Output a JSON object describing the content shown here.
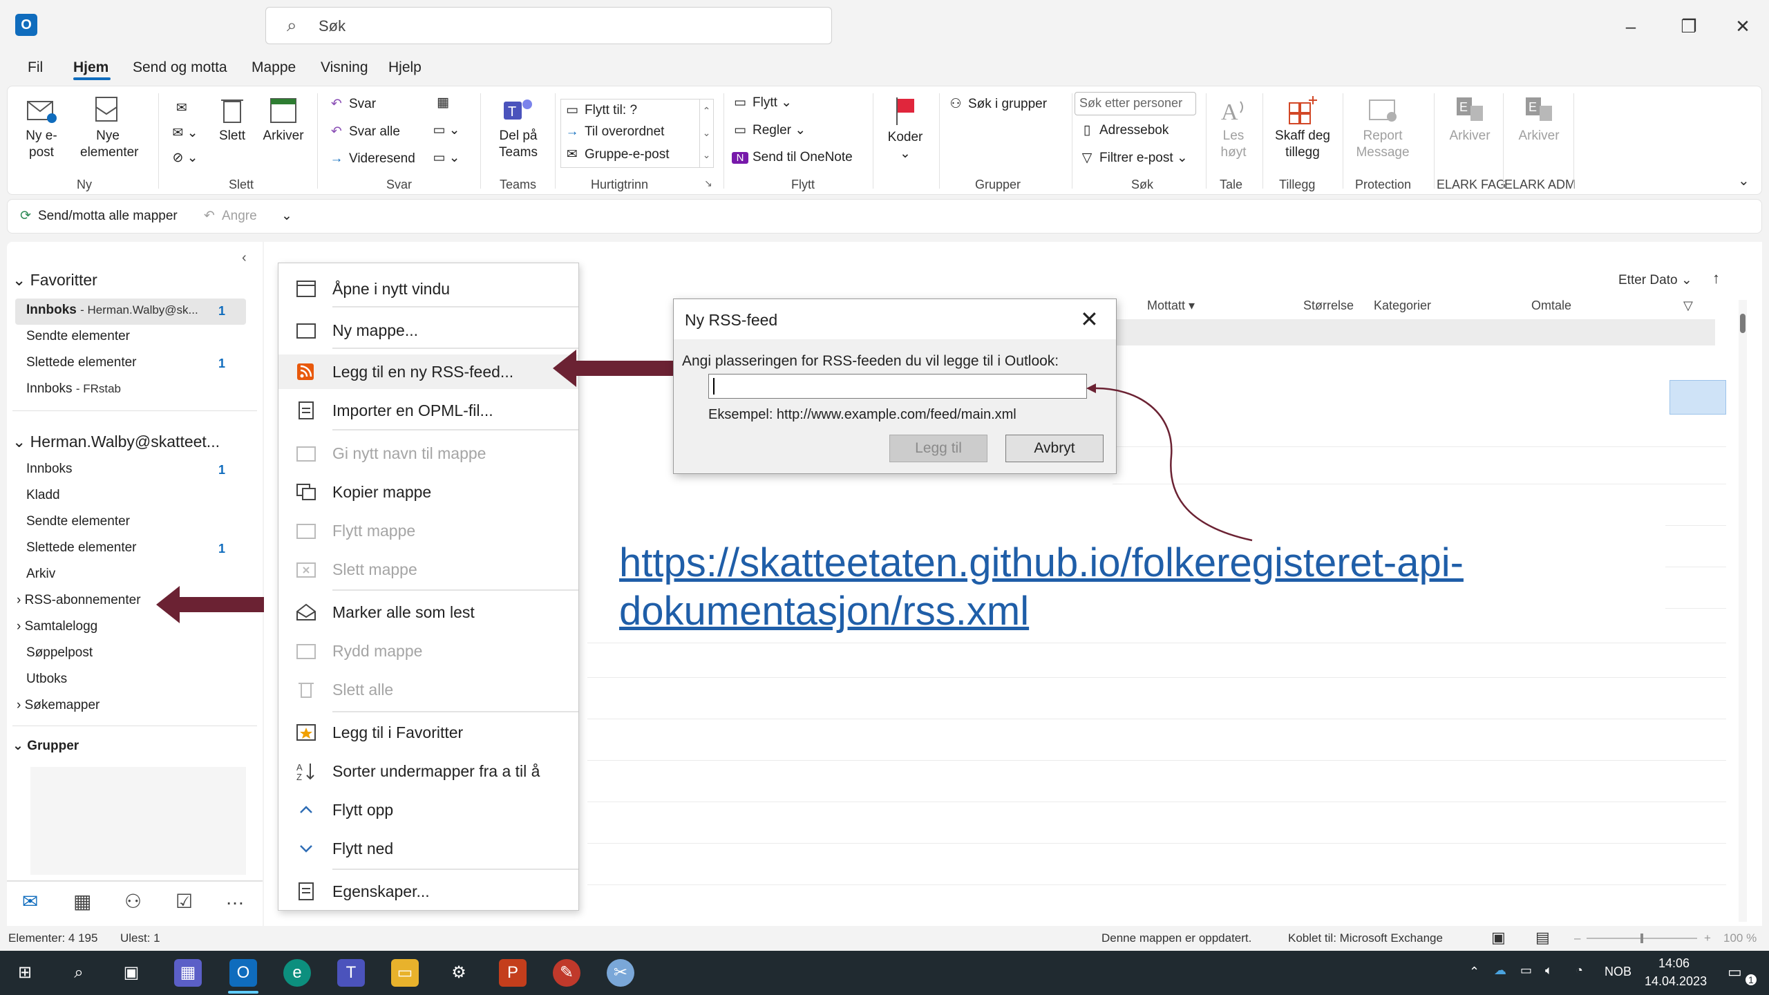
{
  "app": {
    "search_placeholder": "Søk",
    "colors": {
      "accent": "#0f6cbd",
      "arrow": "#6b2233",
      "link": "#1f5ea8"
    }
  },
  "menu": {
    "tabs": [
      "Fil",
      "Hjem",
      "Send og motta",
      "Mappe",
      "Visning",
      "Hjelp"
    ],
    "active": "Hjem"
  },
  "ribbon": {
    "ny": {
      "ny_epost": "Ny e-post",
      "nye_elementer": "Nye elementer",
      "label": "Ny"
    },
    "slett": {
      "slett": "Slett",
      "arkiver": "Arkiver",
      "label": "Slett"
    },
    "svar": {
      "svar": "Svar",
      "svar_alle": "Svar alle",
      "videresend": "Videresend",
      "label": "Svar"
    },
    "teams": {
      "del": "Del på Teams",
      "label": "Teams"
    },
    "hurtigtrinn": {
      "items": [
        "Flytt til: ?",
        "Til overordnet",
        "Gruppe-e-post"
      ],
      "label": "Hurtigtrinn"
    },
    "flytt": {
      "flytt": "Flytt",
      "regler": "Regler",
      "onenote": "Send til OneNote",
      "label": "Flytt"
    },
    "koder": {
      "koder": "Koder"
    },
    "grupper": {
      "sok": "Søk i grupper",
      "label": "Grupper"
    },
    "sok": {
      "placeholder": "Søk etter personer",
      "adressebok": "Adressebok",
      "filtrer": "Filtrer e-post",
      "label": "Søk"
    },
    "tale": {
      "les": "Les høyt",
      "label": "Tale"
    },
    "tillegg": {
      "skaff": "Skaff deg tillegg",
      "label": "Tillegg"
    },
    "protection": {
      "report": "Report Message",
      "label": "Protection"
    },
    "elark_fag": {
      "arkiver": "Arkiver",
      "label": "ELARK FAG"
    },
    "elark_adm": {
      "arkiver": "Arkiver",
      "label": "ELARK ADM"
    }
  },
  "quickbar": {
    "send_motta": "Send/motta alle mapper",
    "angre": "Angre"
  },
  "folders": {
    "favorites_header": "Favoritter",
    "favorites": [
      {
        "label": "Innboks",
        "suffix": "- Herman.Walby@sk...",
        "count": "1"
      },
      {
        "label": "Sendte elementer",
        "count": ""
      },
      {
        "label": "Slettede elementer",
        "count": "1"
      },
      {
        "label": "Innboks",
        "suffix": "- FRstab",
        "count": ""
      }
    ],
    "account_header": "Herman.Walby@skatteet...",
    "account": [
      {
        "label": "Innboks",
        "count": "1",
        "chevron": ""
      },
      {
        "label": "Kladd",
        "count": "",
        "chevron": ""
      },
      {
        "label": "Sendte elementer",
        "count": "",
        "chevron": ""
      },
      {
        "label": "Slettede elementer",
        "count": "1",
        "chevron": ""
      },
      {
        "label": "Arkiv",
        "count": "",
        "chevron": ""
      },
      {
        "label": "RSS-abonnementer",
        "count": "",
        "chevron": "›"
      },
      {
        "label": "Samtalelogg",
        "count": "",
        "chevron": "›"
      },
      {
        "label": "Søppelpost",
        "count": "",
        "chevron": ""
      },
      {
        "label": "Utboks",
        "count": "",
        "chevron": ""
      },
      {
        "label": "Søkemapper",
        "count": "",
        "chevron": "›"
      }
    ],
    "groups_header": "Grupper"
  },
  "msglist": {
    "sort_label": "Etter Dato",
    "columns": [
      "Mottatt",
      "Størrelse",
      "Kategorier",
      "Omtale"
    ]
  },
  "context_menu": [
    {
      "label": "Åpne i nytt vindu",
      "disabled": false
    },
    {
      "label": "Ny mappe...",
      "disabled": false
    },
    {
      "label": "Legg til en ny RSS-feed...",
      "disabled": false
    },
    {
      "label": "Importer en OPML-fil...",
      "disabled": false
    },
    {
      "label": "Gi nytt navn til mappe",
      "disabled": true
    },
    {
      "label": "Kopier mappe",
      "disabled": false
    },
    {
      "label": "Flytt mappe",
      "disabled": true
    },
    {
      "label": "Slett mappe",
      "disabled": true
    },
    {
      "label": "Marker alle som lest",
      "disabled": false
    },
    {
      "label": "Rydd mappe",
      "disabled": true
    },
    {
      "label": "Slett alle",
      "disabled": true
    },
    {
      "label": "Legg til i Favoritter",
      "disabled": false
    },
    {
      "label": "Sorter undermapper fra a til å",
      "disabled": false
    },
    {
      "label": "Flytt opp",
      "disabled": false
    },
    {
      "label": "Flytt ned",
      "disabled": false
    },
    {
      "label": "Egenskaper...",
      "disabled": false
    }
  ],
  "dialog": {
    "title": "Ny RSS-feed",
    "prompt": "Angi plasseringen for RSS-feeden du vil legge til i Outlook:",
    "input_value": "",
    "example": "Eksempel: http://www.example.com/feed/main.xml",
    "add_button": "Legg til",
    "cancel_button": "Avbryt"
  },
  "annotation": {
    "link": "https://skatteetaten.github.io/folkeregisteret-api-dokumentasjon/rss.xml",
    "link_line1": "https://skatteetaten.github.io/folkeregisteret-api-",
    "link_line2": "dokumentasjon/rss.xml"
  },
  "statusbar": {
    "elements": "Elementer: 4 195",
    "unread": "Ulest: 1",
    "updated": "Denne mappen er oppdatert.",
    "connected": "Koblet til: Microsoft Exchange",
    "zoom": "100 %"
  },
  "taskbar": {
    "lang": "NOB",
    "time": "14:06",
    "date": "14.04.2023",
    "notifications": "1"
  }
}
